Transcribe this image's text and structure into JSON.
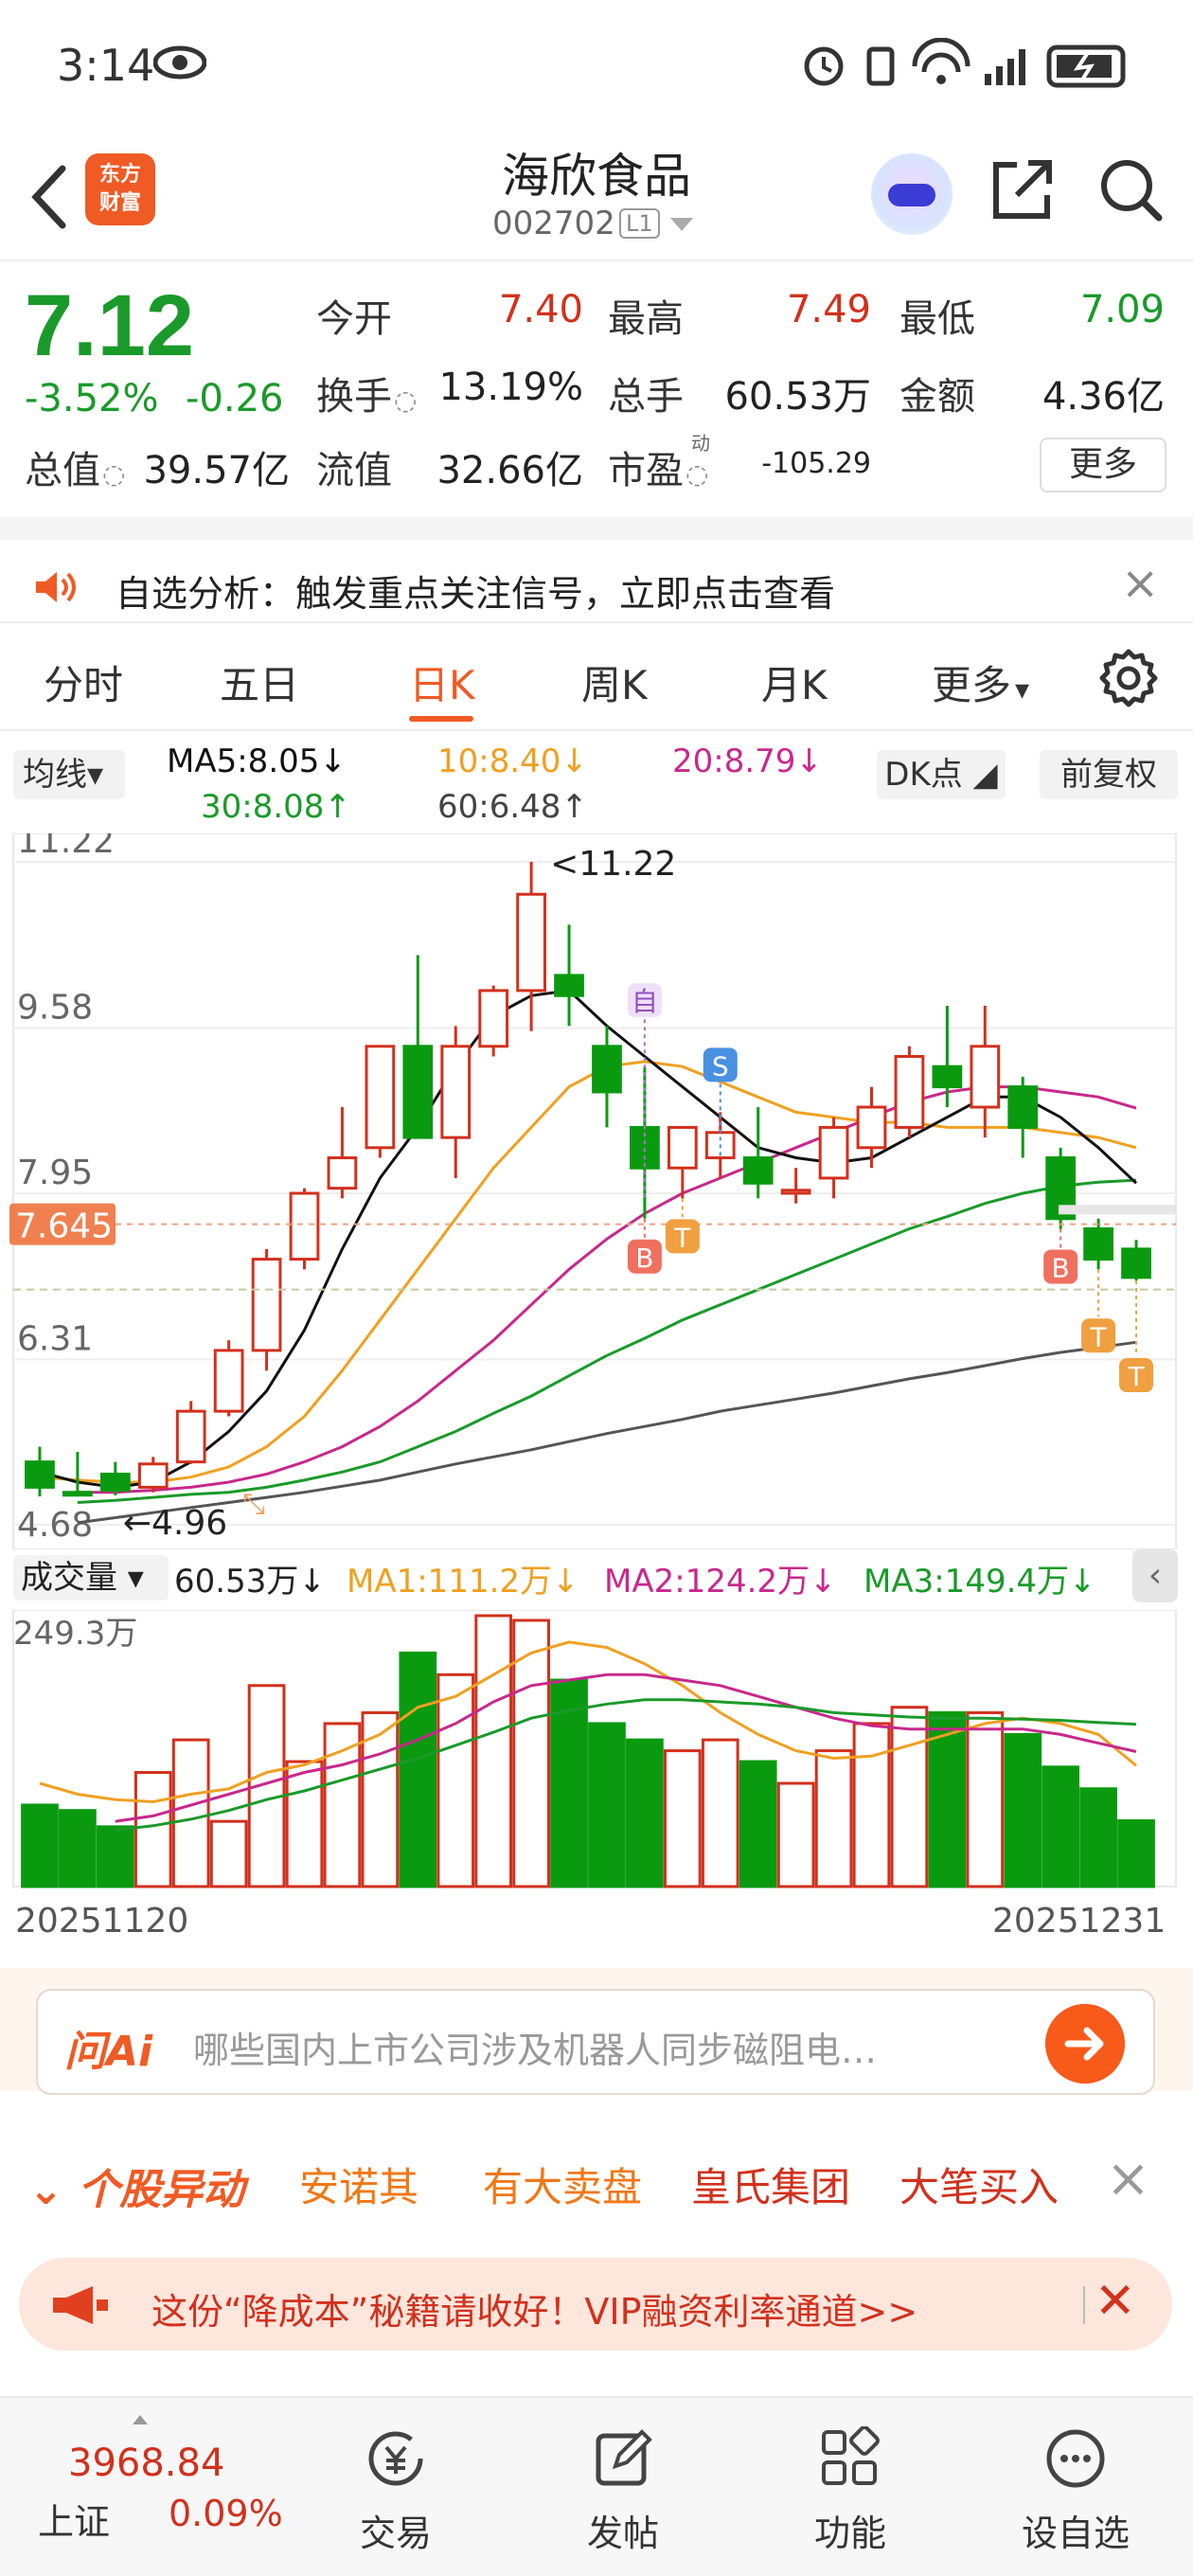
{
  "status_bar": {
    "time": "3:14"
  },
  "header": {
    "logo_text_1": "东方",
    "logo_text_2": "财富",
    "stock_name": "海欣食品",
    "stock_code": "002702",
    "level_badge": "L1"
  },
  "quote": {
    "price": "7.12",
    "change_pct": "-3.52%",
    "change_amt": "-0.26",
    "fields": [
      {
        "label": "今开",
        "value": "7.40",
        "color": "#d2301c"
      },
      {
        "label": "最高",
        "value": "7.49",
        "color": "#d2301c"
      },
      {
        "label": "最低",
        "value": "7.09",
        "color": "#1a9a2a"
      },
      {
        "label": "换手",
        "value": "13.19%",
        "color": "#222222"
      },
      {
        "label": "总手",
        "value": "60.53万",
        "color": "#222222"
      },
      {
        "label": "金额",
        "value": "4.36亿",
        "color": "#222222"
      },
      {
        "label": "总值",
        "value": "39.57亿",
        "color": "#222222"
      },
      {
        "label": "流值",
        "value": "32.66亿",
        "color": "#222222"
      },
      {
        "label": "市盈",
        "value": "-105.29",
        "color": "#222222"
      }
    ],
    "pe_superscript": "动",
    "more_label": "更多"
  },
  "notice": {
    "text": "自选分析：触发重点关注信号，立即点击查看"
  },
  "tabs": [
    {
      "label": "分时",
      "active": false
    },
    {
      "label": "五日",
      "active": false
    },
    {
      "label": "日K",
      "active": true
    },
    {
      "label": "周K",
      "active": false
    },
    {
      "label": "月K",
      "active": false
    },
    {
      "label": "更多",
      "active": false
    }
  ],
  "ma_row": {
    "selector_label": "均线",
    "ma5": "MA5:8.05",
    "ma10": "10:8.40",
    "ma20": "20:8.79",
    "ma30": "30:8.08",
    "ma60": "60:6.48",
    "dk_label": "DK点",
    "fq_label": "前复权"
  },
  "colors": {
    "up": "#d2301c",
    "down": "#0a9a10",
    "ma5": "#111111",
    "ma10": "#f0a020",
    "ma20": "#c8288c",
    "ma30": "#1a9a2a",
    "ma60": "#555555",
    "accent": "#f05a24"
  },
  "chart_data": [
    {
      "type": "candlestick",
      "y_ticks": [
        "11.22",
        "9.58",
        "7.95",
        "6.31",
        "4.68"
      ],
      "ylim": [
        4.68,
        11.22
      ],
      "current_price_label": "7.645",
      "current_price": 7.645,
      "high_label": "11.22",
      "low_label": "4.96",
      "candles": [
        {
          "o": 5.3,
          "h": 5.45,
          "l": 4.96,
          "c": 5.05
        },
        {
          "o": 5.0,
          "h": 5.4,
          "l": 4.96,
          "c": 4.98
        },
        {
          "o": 5.18,
          "h": 5.3,
          "l": 4.97,
          "c": 5.02
        },
        {
          "o": 5.05,
          "h": 5.35,
          "l": 5.0,
          "c": 5.28
        },
        {
          "o": 5.3,
          "h": 5.9,
          "l": 5.28,
          "c": 5.8
        },
        {
          "o": 5.8,
          "h": 6.5,
          "l": 5.75,
          "c": 6.4
        },
        {
          "o": 6.4,
          "h": 7.4,
          "l": 6.2,
          "c": 7.3
        },
        {
          "o": 7.3,
          "h": 8.0,
          "l": 7.2,
          "c": 7.95
        },
        {
          "o": 8.0,
          "h": 8.8,
          "l": 7.9,
          "c": 8.3
        },
        {
          "o": 8.4,
          "h": 9.4,
          "l": 8.3,
          "c": 9.4
        },
        {
          "o": 9.4,
          "h": 10.3,
          "l": 8.5,
          "c": 8.5
        },
        {
          "o": 8.5,
          "h": 9.6,
          "l": 8.1,
          "c": 9.4
        },
        {
          "o": 9.4,
          "h": 10.0,
          "l": 9.3,
          "c": 9.95
        },
        {
          "o": 9.95,
          "h": 11.22,
          "l": 9.55,
          "c": 10.9
        },
        {
          "o": 10.1,
          "h": 10.6,
          "l": 9.6,
          "c": 9.9
        },
        {
          "o": 9.4,
          "h": 9.6,
          "l": 8.6,
          "c": 8.95
        },
        {
          "o": 8.6,
          "h": 9.2,
          "l": 7.7,
          "c": 8.2
        },
        {
          "o": 8.2,
          "h": 8.6,
          "l": 7.9,
          "c": 8.6
        },
        {
          "o": 8.3,
          "h": 8.75,
          "l": 8.1,
          "c": 8.55
        },
        {
          "o": 8.3,
          "h": 8.8,
          "l": 7.9,
          "c": 8.05
        },
        {
          "o": 7.95,
          "h": 8.2,
          "l": 7.85,
          "c": 7.98
        },
        {
          "o": 8.1,
          "h": 8.7,
          "l": 7.9,
          "c": 8.6
        },
        {
          "o": 8.4,
          "h": 9.0,
          "l": 8.2,
          "c": 8.8
        },
        {
          "o": 8.6,
          "h": 9.4,
          "l": 8.5,
          "c": 9.3
        },
        {
          "o": 9.2,
          "h": 9.8,
          "l": 8.8,
          "c": 9.0
        },
        {
          "o": 8.8,
          "h": 9.8,
          "l": 8.5,
          "c": 9.4
        },
        {
          "o": 9.0,
          "h": 9.1,
          "l": 8.3,
          "c": 8.6
        },
        {
          "o": 8.3,
          "h": 8.4,
          "l": 7.6,
          "c": 7.7
        },
        {
          "o": 7.6,
          "h": 7.7,
          "l": 7.2,
          "c": 7.3
        },
        {
          "o": 7.4,
          "h": 7.49,
          "l": 7.09,
          "c": 7.12
        }
      ],
      "ma5": [
        5.2,
        5.1,
        5.05,
        5.1,
        5.3,
        5.6,
        6.0,
        6.6,
        7.4,
        8.1,
        8.6,
        9.2,
        9.7,
        9.9,
        9.95,
        9.6,
        9.3,
        9.0,
        8.7,
        8.4,
        8.3,
        8.25,
        8.3,
        8.5,
        8.7,
        8.9,
        8.9,
        8.7,
        8.4,
        8.05
      ],
      "ma10": [
        5.15,
        5.12,
        5.1,
        5.1,
        5.15,
        5.25,
        5.45,
        5.75,
        6.2,
        6.7,
        7.2,
        7.7,
        8.2,
        8.6,
        9.0,
        9.2,
        9.25,
        9.2,
        9.05,
        8.9,
        8.75,
        8.7,
        8.65,
        8.65,
        8.6,
        8.6,
        8.6,
        8.55,
        8.5,
        8.4
      ],
      "ma20": [
        null,
        5.0,
        5.0,
        5.02,
        5.05,
        5.1,
        5.18,
        5.3,
        5.45,
        5.65,
        5.9,
        6.2,
        6.5,
        6.85,
        7.2,
        7.5,
        7.75,
        7.95,
        8.1,
        8.25,
        8.4,
        8.55,
        8.7,
        8.85,
        8.95,
        9.0,
        9.0,
        8.95,
        8.9,
        8.79
      ],
      "ma30": [
        null,
        4.9,
        4.92,
        4.95,
        4.98,
        5.0,
        5.05,
        5.12,
        5.2,
        5.3,
        5.45,
        5.6,
        5.78,
        5.95,
        6.15,
        6.35,
        6.52,
        6.7,
        6.85,
        7.0,
        7.15,
        7.3,
        7.45,
        7.6,
        7.72,
        7.85,
        7.95,
        8.02,
        8.06,
        8.08
      ],
      "ma60": [
        null,
        4.7,
        4.75,
        4.8,
        4.85,
        4.9,
        4.95,
        5.0,
        5.06,
        5.12,
        5.2,
        5.28,
        5.35,
        5.42,
        5.5,
        5.58,
        5.65,
        5.72,
        5.8,
        5.86,
        5.92,
        5.98,
        6.05,
        6.12,
        6.18,
        6.25,
        6.32,
        6.38,
        6.43,
        6.48
      ],
      "markers": [
        {
          "index": 16,
          "label": "B",
          "color": "#f07060"
        },
        {
          "index": 17,
          "label": "T",
          "color": "#f0a040"
        },
        {
          "index": 16,
          "label": "自",
          "color": "#b070d0"
        },
        {
          "index": 18,
          "label": "S",
          "color": "#4a90e2"
        },
        {
          "index": 27,
          "label": "B",
          "color": "#f07060"
        },
        {
          "index": 28,
          "label": "T",
          "color": "#f0a040"
        },
        {
          "index": 29,
          "label": "T",
          "color": "#f0a040"
        }
      ]
    },
    {
      "type": "bar",
      "title": "成交量",
      "last": "60.53万",
      "ma1_label": "MA1:111.2万",
      "ma2_label": "MA2:124.2万",
      "ma3_label": "MA3:149.4万",
      "y_max_label": "249.3万",
      "ylim": [
        0,
        249.3
      ],
      "values": [
        75,
        70,
        55,
        105,
        135,
        60,
        185,
        115,
        150,
        160,
        215,
        195,
        249.3,
        245,
        190,
        150,
        135,
        125,
        135,
        115,
        95,
        125,
        150,
        165,
        160,
        160,
        140,
        110,
        90,
        60.53
      ],
      "ma1": [
        95,
        85,
        80,
        78,
        85,
        90,
        105,
        112,
        125,
        140,
        165,
        175,
        195,
        215,
        225,
        220,
        205,
        185,
        160,
        140,
        125,
        118,
        120,
        130,
        140,
        150,
        155,
        150,
        140,
        111.2
      ],
      "ma2": [
        null,
        null,
        60,
        65,
        75,
        85,
        95,
        105,
        112,
        122,
        135,
        150,
        170,
        185,
        190,
        195,
        195,
        190,
        185,
        175,
        165,
        155,
        148,
        145,
        145,
        145,
        145,
        140,
        132,
        124.2
      ],
      "ma3": [
        null,
        null,
        52,
        56,
        62,
        70,
        80,
        88,
        98,
        108,
        118,
        130,
        142,
        155,
        162,
        168,
        172,
        172,
        170,
        168,
        165,
        160,
        158,
        156,
        155,
        155,
        154,
        153,
        151,
        149.4
      ]
    }
  ],
  "dates": {
    "start": "20251120",
    "end": "20251231"
  },
  "ai": {
    "logo": "问Ai",
    "placeholder": "哪些国内上市公司涉及机器人同步磁阻电…"
  },
  "hot": {
    "title": "个股异动",
    "items": [
      {
        "label": "安诺其",
        "color": "#f07818"
      },
      {
        "label": "有大卖盘",
        "color": "#f07818"
      },
      {
        "label": "皇氏集团",
        "color": "#d2301c"
      },
      {
        "label": "大笔买入",
        "color": "#d2301c"
      }
    ]
  },
  "banner": {
    "text": "这份“降成本”秘籍请收好！VIP融资利率通道>>"
  },
  "bottom_nav": {
    "index_value": "3968.84",
    "index_name": "上证",
    "index_pct": "0.09%",
    "items": [
      "交易",
      "发帖",
      "功能",
      "设自选"
    ]
  }
}
